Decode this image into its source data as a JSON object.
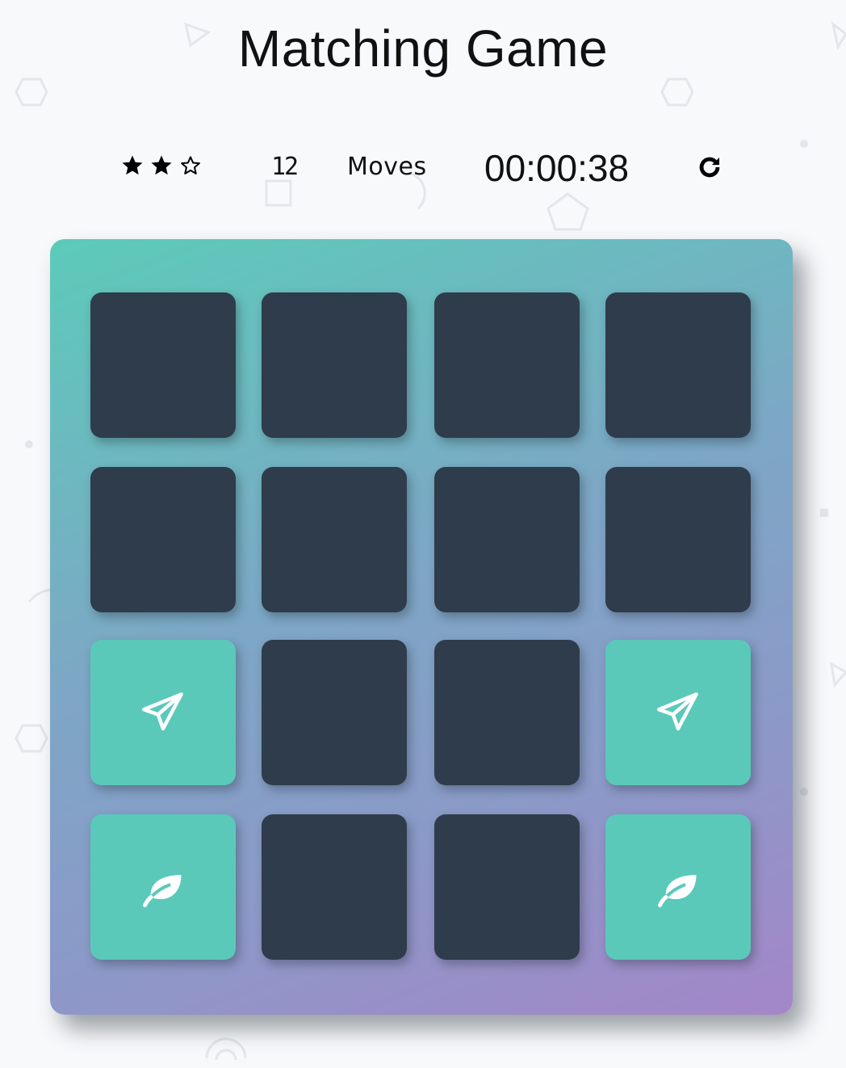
{
  "title": "Matching Game",
  "score_panel": {
    "stars": [
      {
        "state": "filled",
        "icon": "star-filled-icon"
      },
      {
        "state": "filled",
        "icon": "star-filled-icon"
      },
      {
        "state": "empty",
        "icon": "star-outline-icon"
      }
    ],
    "moves_count": "12",
    "moves_label": "Moves",
    "timer": "00:00:38",
    "restart_icon": "restart-icon"
  },
  "deck": {
    "cards": [
      {
        "state": "hidden",
        "icon": ""
      },
      {
        "state": "hidden",
        "icon": ""
      },
      {
        "state": "hidden",
        "icon": ""
      },
      {
        "state": "hidden",
        "icon": ""
      },
      {
        "state": "hidden",
        "icon": ""
      },
      {
        "state": "hidden",
        "icon": ""
      },
      {
        "state": "hidden",
        "icon": ""
      },
      {
        "state": "hidden",
        "icon": ""
      },
      {
        "state": "match",
        "icon": "paper-plane-icon"
      },
      {
        "state": "hidden",
        "icon": ""
      },
      {
        "state": "hidden",
        "icon": ""
      },
      {
        "state": "match",
        "icon": "paper-plane-icon"
      },
      {
        "state": "match",
        "icon": "leaf-icon"
      },
      {
        "state": "hidden",
        "icon": ""
      },
      {
        "state": "hidden",
        "icon": ""
      },
      {
        "state": "match",
        "icon": "leaf-icon"
      }
    ]
  },
  "colors": {
    "card_back": "#2f3c4b",
    "card_match": "#5ac9b9",
    "deck_gradient_start": "#5ccbb9",
    "deck_gradient_end": "#a486c8",
    "page_background": "#f8f9fb"
  }
}
